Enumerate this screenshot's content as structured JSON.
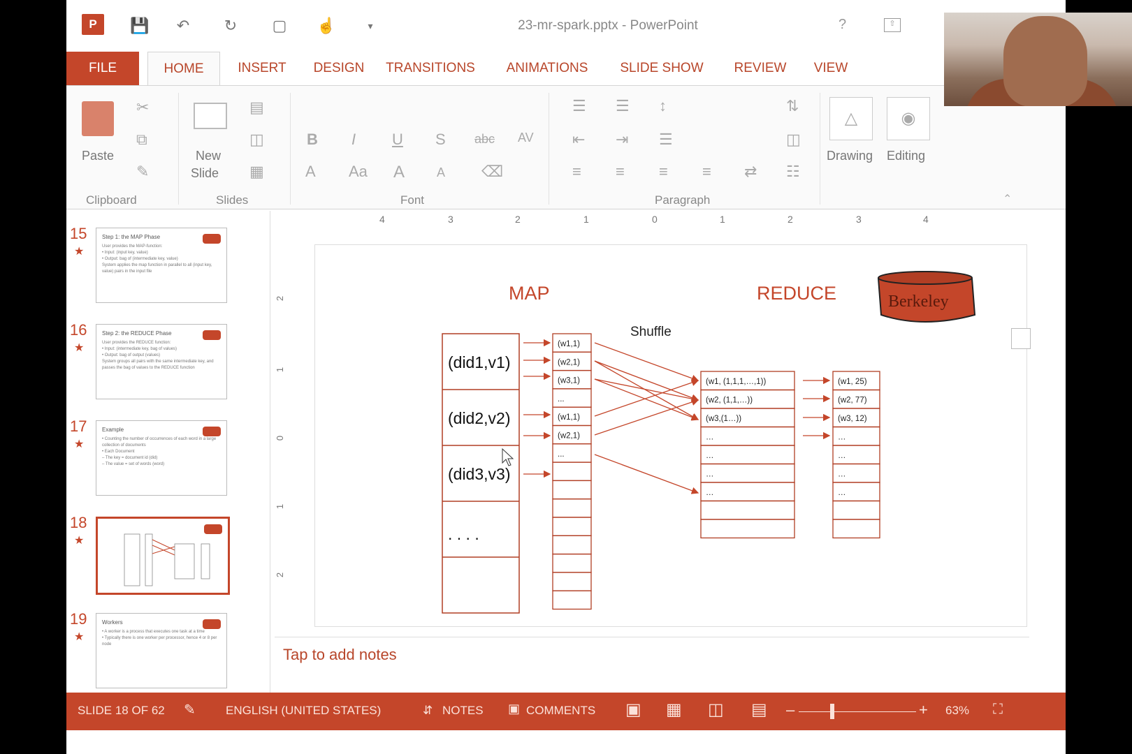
{
  "window": {
    "title": "23-mr-spark.pptx - PowerPoint",
    "help": "?"
  },
  "tabs": [
    "FILE",
    "HOME",
    "INSERT",
    "DESIGN",
    "TRANSITIONS",
    "ANIMATIONS",
    "SLIDE SHOW",
    "REVIEW",
    "VIEW"
  ],
  "ribbon": {
    "paste": "Paste",
    "new_slide_line1": "New",
    "new_slide_line2": "Slide",
    "drawing": "Drawing",
    "editing": "Editing",
    "groups": {
      "clipboard": "Clipboard",
      "slides": "Slides",
      "font": "Font",
      "paragraph": "Paragraph"
    },
    "font_buttons": {
      "bold": "B",
      "italic": "I",
      "underline": "U",
      "shadow": "S",
      "strike": "abc",
      "spacing": "AV",
      "grow": "A",
      "case": "Aa",
      "font_size_up": "A",
      "font_size_down": "A"
    }
  },
  "thumbnails": [
    {
      "num": "15",
      "title": "Step 1: the MAP Phase",
      "lines": [
        "User provides the MAP-function:",
        "• Input: (input key, value)",
        "• Output: bag of (intermediate key, value)",
        "System applies the map function in parallel to all (input key, value) pairs in the input file"
      ]
    },
    {
      "num": "16",
      "title": "Step 2: the REDUCE Phase",
      "lines": [
        "User provides the REDUCE function:",
        "• Input: (intermediate key, bag of values)",
        "• Output: bag of output (values)",
        "System groups all pairs with the same intermediate key, and passes the bag of values to the REDUCE function"
      ]
    },
    {
      "num": "17",
      "title": "Example",
      "lines": [
        "• Counting the number of occurrences of each word in a large collection of documents",
        "• Each Document",
        "  – The key = document id (did)",
        "  – The value = set of words (word)"
      ]
    },
    {
      "num": "18",
      "title": "",
      "lines": []
    },
    {
      "num": "19",
      "title": "Workers",
      "lines": [
        "• A worker is a process that executes one task at a time",
        "• Typically there is one worker per processor, hence 4 or 8 per node"
      ]
    }
  ],
  "ruler": {
    "h": [
      "4",
      "3",
      "2",
      "1",
      "0",
      "1",
      "2",
      "3",
      "4"
    ],
    "v": [
      "2",
      "1",
      "0",
      "1",
      "2"
    ]
  },
  "slide": {
    "map_title": "MAP",
    "reduce_title": "REDUCE",
    "logo": "Berkeley",
    "shuffle": "Shuffle",
    "inputs": [
      "(did1,v1)",
      "(did2,v2)",
      "(did3,v3)",
      ". . . ."
    ],
    "map_out": [
      "(w1,1)",
      "(w2,1)",
      "(w3,1)",
      "...",
      "(w1,1)",
      "(w2,1)",
      "..."
    ],
    "groups": [
      "(w1, (1,1,1,…,1))",
      "(w2, (1,1,…))",
      "(w3,(1…))",
      "…",
      "…",
      "…",
      "…"
    ],
    "results": [
      "(w1, 25)",
      "(w2, 77)",
      "(w3, 12)",
      "…",
      "…",
      "…",
      "…"
    ],
    "accent": "#c4462a"
  },
  "notes": {
    "placeholder": "Tap to add notes"
  },
  "status": {
    "slide_pos": "SLIDE 18 OF 62",
    "language": "ENGLISH (UNITED STATES)",
    "notes": "NOTES",
    "comments": "COMMENTS",
    "zoom": "63%",
    "minus": "–",
    "plus": "+"
  }
}
